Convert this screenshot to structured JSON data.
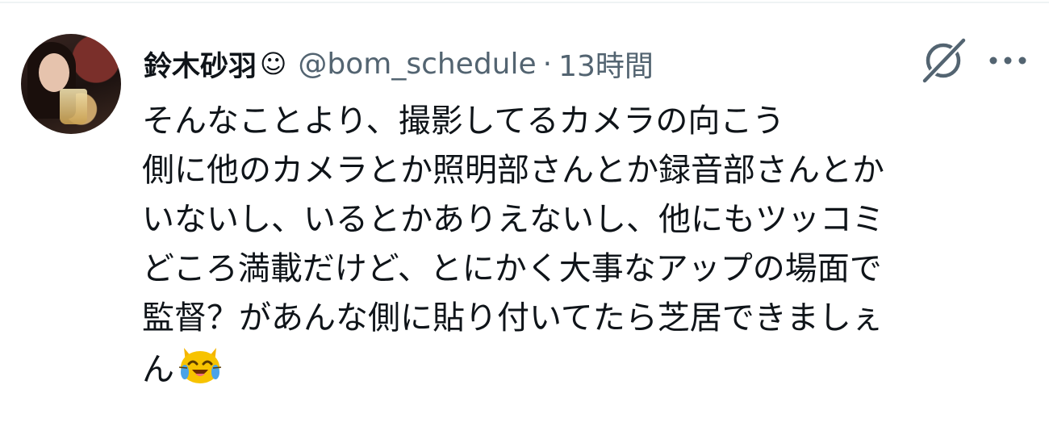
{
  "tweet": {
    "display_name": "鈴木砂羽",
    "name_emoji": "☺",
    "handle": "@bom_schedule",
    "separator": "·",
    "time": "13時間",
    "text_lines": [
      "そんなことより、撮影してるカメラの向こう",
      "側に他のカメラとか照明部さんとか録音部さんとか",
      "いないし、いるとかありえないし、他にもツッコミ",
      "どころ満載だけど、とにかく大事なアップの場面で",
      "監督？があんな側に貼り付いてたら芝居できましぇ",
      "ん"
    ],
    "trailing_emoji": "laughing-cat-with-tears"
  },
  "icons": {
    "grok": "grok-icon",
    "more": "more-icon"
  },
  "colors": {
    "text": "#0f1419",
    "secondary": "#536471",
    "divider": "#eff3f4"
  }
}
